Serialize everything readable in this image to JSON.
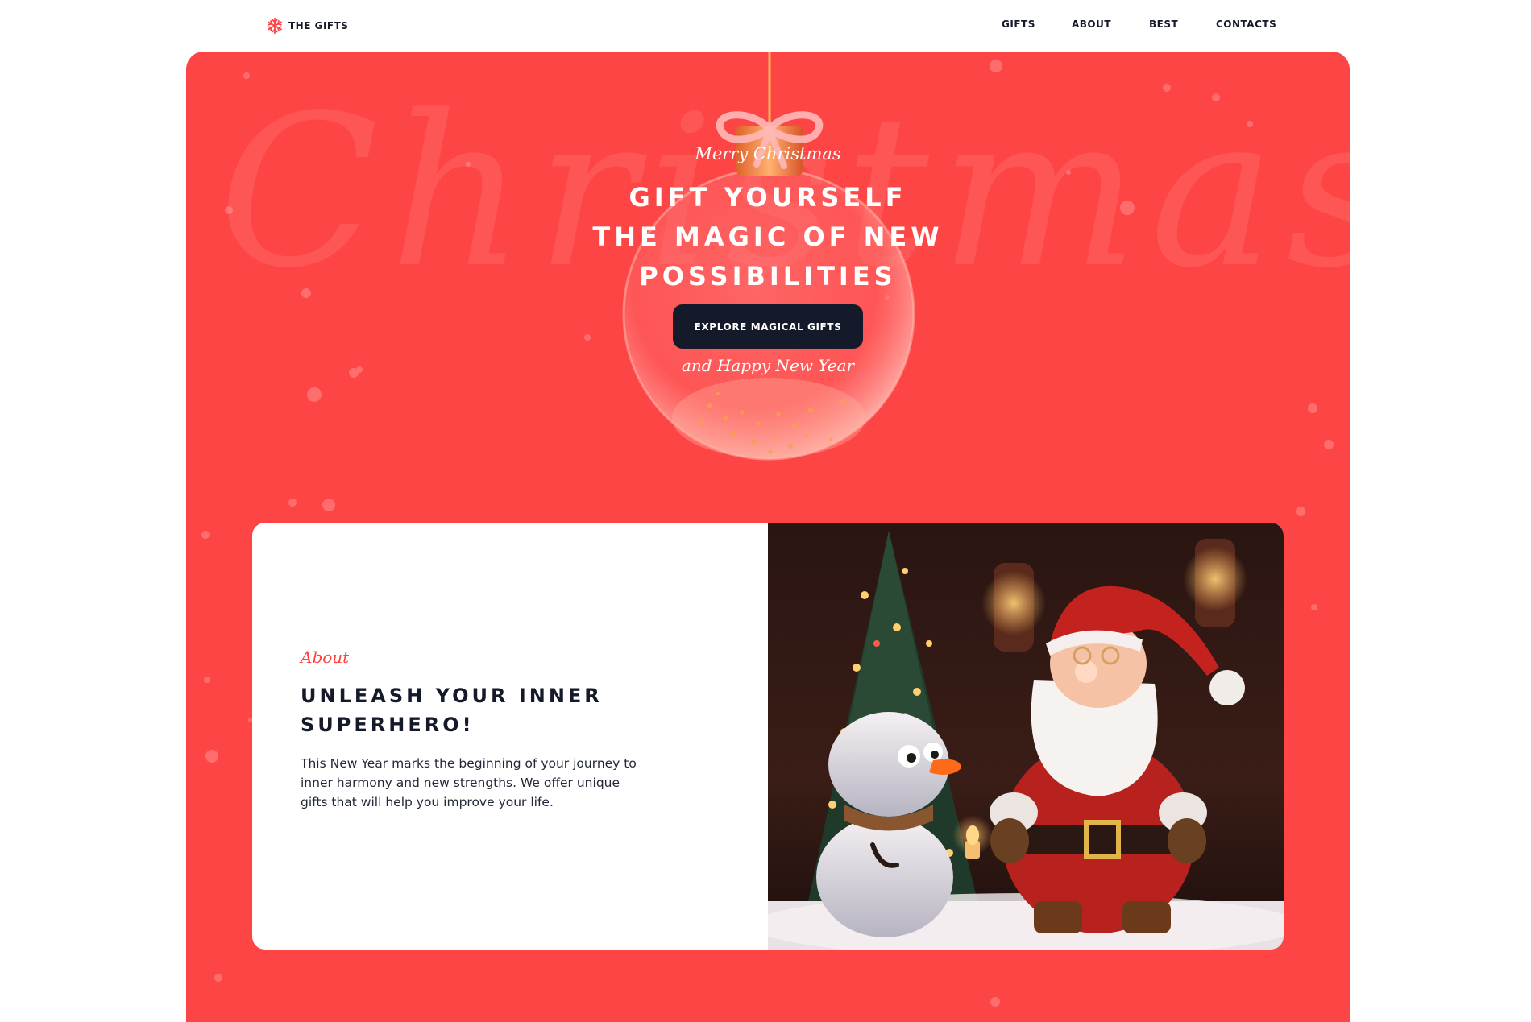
{
  "header": {
    "brand": "THE GIFTS",
    "nav": [
      "GIFTS",
      "ABOUT",
      "BEST",
      "CONTACTS"
    ]
  },
  "hero": {
    "background_word": "Christmas",
    "greeting_top": "Merry Christmas",
    "title_lines": [
      "GIFT YOURSELF",
      "THE MAGIC OF NEW",
      "POSSIBILITIES"
    ],
    "cta_label": "EXPLORE MAGICAL GIFTS",
    "greeting_bottom": "and Happy New Year"
  },
  "about": {
    "label": "About",
    "title_lines": [
      "UNLEASH YOUR INNER",
      "SUPERHERO!"
    ],
    "body": "This New Year marks the beginning of your journey to inner harmony and new strengths. We offer unique gifts that will help you improve your life."
  },
  "icons": {
    "logo": "snowflake-icon",
    "ornament": "christmas-ornament-illustration",
    "photo": "snowman-and-santa-illustration"
  },
  "colors": {
    "accent": "#fe4545",
    "dark": "#151a2b",
    "text": "#141a2a",
    "background": "#ffffff"
  }
}
